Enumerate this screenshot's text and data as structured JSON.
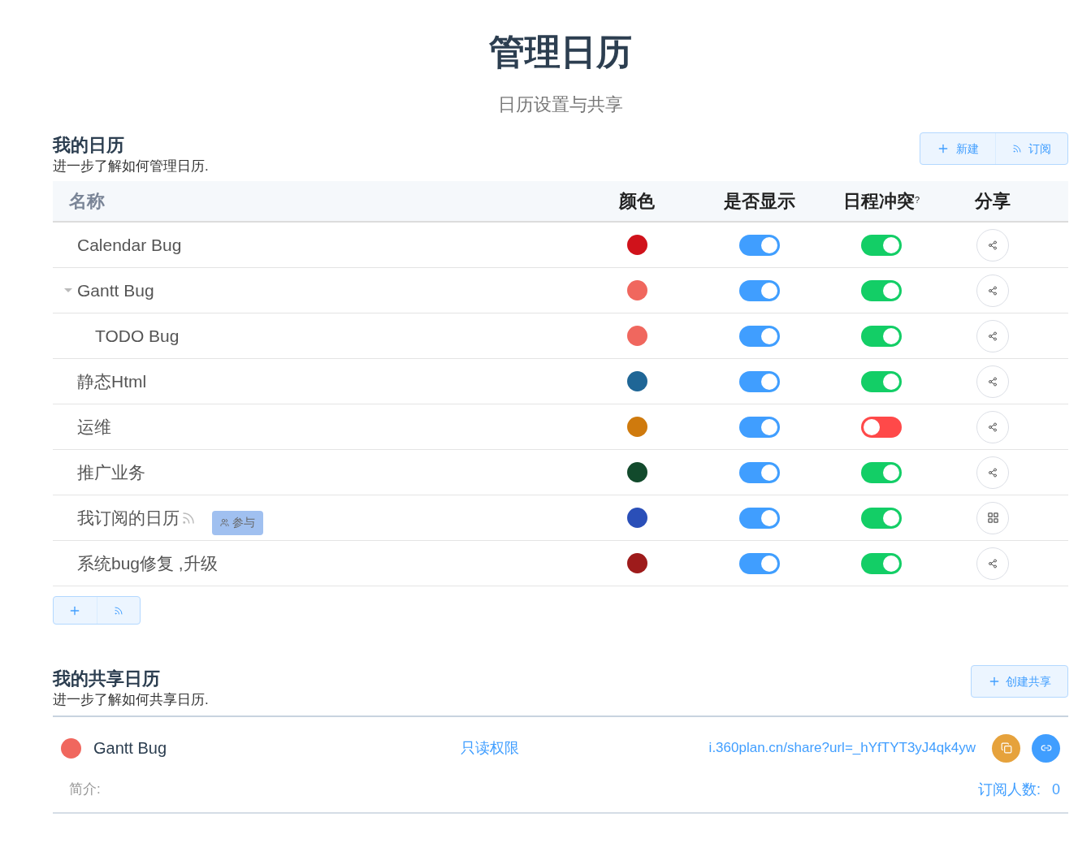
{
  "page": {
    "title": "管理日历",
    "subtitle": "日历设置与共享"
  },
  "my_calendars": {
    "title": "我的日历",
    "description": "进一步了解如何管理日历.",
    "buttons": [
      {
        "kind": "new",
        "label": "新建"
      },
      {
        "kind": "subscribe",
        "label": "订阅"
      }
    ],
    "columns": [
      "名称",
      "颜色",
      "是否显示",
      "日程冲突",
      "分享"
    ],
    "conflict_hint": "?",
    "rows": [
      {
        "name": "Calendar Bug",
        "color": "#d0121b",
        "visible": true,
        "conflict": true,
        "kind": "share"
      },
      {
        "name": "Gantt Bug",
        "color": "#f0675e",
        "visible": true,
        "conflict": true,
        "kind": "share",
        "expanded": true,
        "children": [
          {
            "name": "TODO Bug",
            "color": "#f0675e",
            "visible": true,
            "conflict": true,
            "kind": "share"
          }
        ]
      },
      {
        "name": "静态Html",
        "color": "#1f6696",
        "visible": true,
        "conflict": true,
        "kind": "share"
      },
      {
        "name": "运维",
        "color": "#cf7a0d",
        "visible": true,
        "conflict": false,
        "kind": "share"
      },
      {
        "name": "推广业务",
        "color": "#124a2c",
        "visible": true,
        "conflict": true,
        "kind": "share"
      },
      {
        "name": "我订阅的日历",
        "color": "#2a4fb8",
        "visible": true,
        "conflict": true,
        "kind": "apps",
        "subscribed": true,
        "badge": "参与"
      },
      {
        "name": "系统bug修复 ,升级",
        "color": "#9e1b1b",
        "visible": true,
        "conflict": true,
        "kind": "share"
      }
    ],
    "footer_buttons": [
      {
        "kind": "new"
      },
      {
        "kind": "subscribe"
      }
    ]
  },
  "shared_calendars": {
    "title": "我的共享日历",
    "description": "进一步了解如何共享日历.",
    "create_button": "创建共享",
    "items": [
      {
        "name": "Gantt Bug",
        "color": "#f0675e",
        "permission": "只读权限",
        "url": "i.360plan.cn/share?url=_hYfTYT3yJ4qk4yw",
        "intro_label": "简介:",
        "subscribers_label": "订阅人数:",
        "subscribers": "0"
      }
    ]
  }
}
